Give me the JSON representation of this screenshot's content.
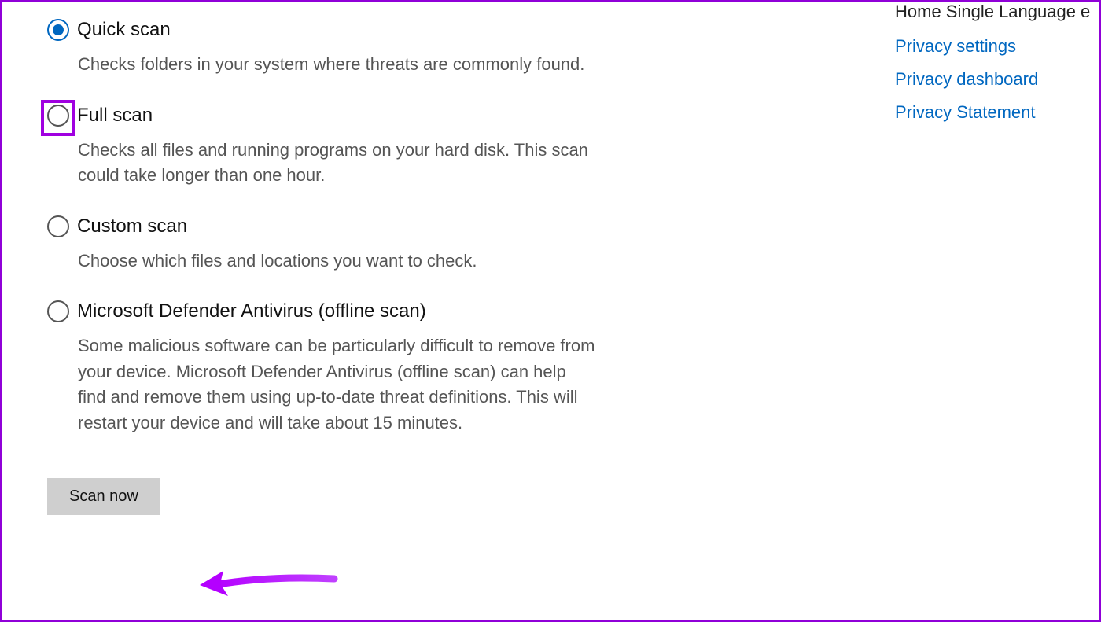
{
  "options": [
    {
      "label": "Quick scan",
      "desc": "Checks folders in your system where threats are commonly found.",
      "selected": true,
      "highlighted": false
    },
    {
      "label": "Full scan",
      "desc": "Checks all files and running programs on your hard disk. This scan could take longer than one hour.",
      "selected": false,
      "highlighted": true
    },
    {
      "label": "Custom scan",
      "desc": "Choose which files and locations you want to check.",
      "selected": false,
      "highlighted": false
    },
    {
      "label": "Microsoft Defender Antivirus (offline scan)",
      "desc": "Some malicious software can be particularly difficult to remove from your device. Microsoft Defender Antivirus (offline scan) can help find and remove them using up-to-date threat definitions. This will restart your device and will take about 15 minutes.",
      "selected": false,
      "highlighted": false
    }
  ],
  "scan_button": "Scan now",
  "sidebar": {
    "title": "Home Single Language e",
    "links": [
      "Privacy settings",
      "Privacy dashboard",
      "Privacy Statement"
    ]
  },
  "colors": {
    "accent": "#0067c0",
    "highlight": "#a000e0",
    "arrow": "#b400ff"
  }
}
